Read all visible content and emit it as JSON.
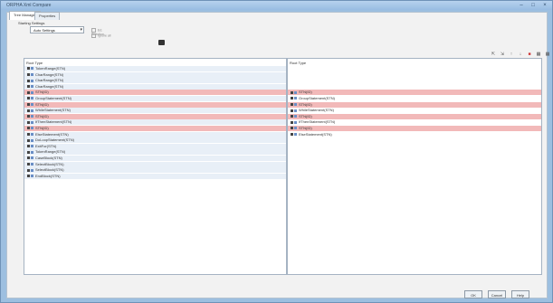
{
  "window": {
    "title": "ORPHA Xml Compare"
  },
  "tabs": [
    {
      "label": "Tree Manager"
    },
    {
      "label": "Properties"
    }
  ],
  "options": {
    "group_label": "Starting Settings",
    "dropdown_value": "Auto Settings",
    "checkbox_a": "Ed. Direction",
    "checkbox_b": "Ignore all"
  },
  "left_pane": {
    "title": "Root Type",
    "rows": [
      {
        "label": "TokenRange(STN)",
        "state": "normal"
      },
      {
        "label": "CharRange(STN)",
        "state": "normal"
      },
      {
        "label": "CharRange(STN)",
        "state": "normal"
      },
      {
        "label": "CharRange(STN)",
        "state": "normal"
      },
      {
        "label": "STN(ID)",
        "state": "diff"
      },
      {
        "label": "GroupStatement(STN)",
        "state": "normal"
      },
      {
        "label": "STN(ID)",
        "state": "diff"
      },
      {
        "label": "WhileStatement(STN)",
        "state": "normal"
      },
      {
        "label": "STN(ID)",
        "state": "diff"
      },
      {
        "label": "IfThenStatement(STN)",
        "state": "normal"
      },
      {
        "label": "STN(ID)",
        "state": "diff"
      },
      {
        "label": "ElseStatement(STN)",
        "state": "normal"
      },
      {
        "label": "DoLoopStatement(STN)",
        "state": "normal"
      },
      {
        "label": "ExitFor(STN)",
        "state": "normal"
      },
      {
        "label": "TokenRange(STN)",
        "state": "normal"
      },
      {
        "label": "CaseBlock(STN)",
        "state": "normal"
      },
      {
        "label": "SelectBlock(STN)",
        "state": "normal"
      },
      {
        "label": "SelectBlock(STN)",
        "state": "normal"
      },
      {
        "label": "EndBlock(STN)",
        "state": "normal"
      }
    ]
  },
  "right_pane": {
    "title": "Root Type",
    "rows": [
      {
        "label": "STN(ID)",
        "state": "diff"
      },
      {
        "label": "GroupStatement(STN)",
        "state": "normal"
      },
      {
        "label": "STN(ID)",
        "state": "diff"
      },
      {
        "label": "WhileStatement(STN)",
        "state": "normal"
      },
      {
        "label": "STN(ID)",
        "state": "diff"
      },
      {
        "label": "IfThenStatement(STN)",
        "state": "normal"
      },
      {
        "label": "STN(ID)",
        "state": "diff"
      },
      {
        "label": "ElseStatement(STN)",
        "state": "normal"
      }
    ]
  },
  "buttons": {
    "ok": "OK",
    "cancel": "Cancel",
    "help": "Help"
  },
  "colors": {
    "diff_highlight": "#f2b9b9",
    "shaded": "#e8eff7",
    "window_frame": "#9dbfe0"
  }
}
